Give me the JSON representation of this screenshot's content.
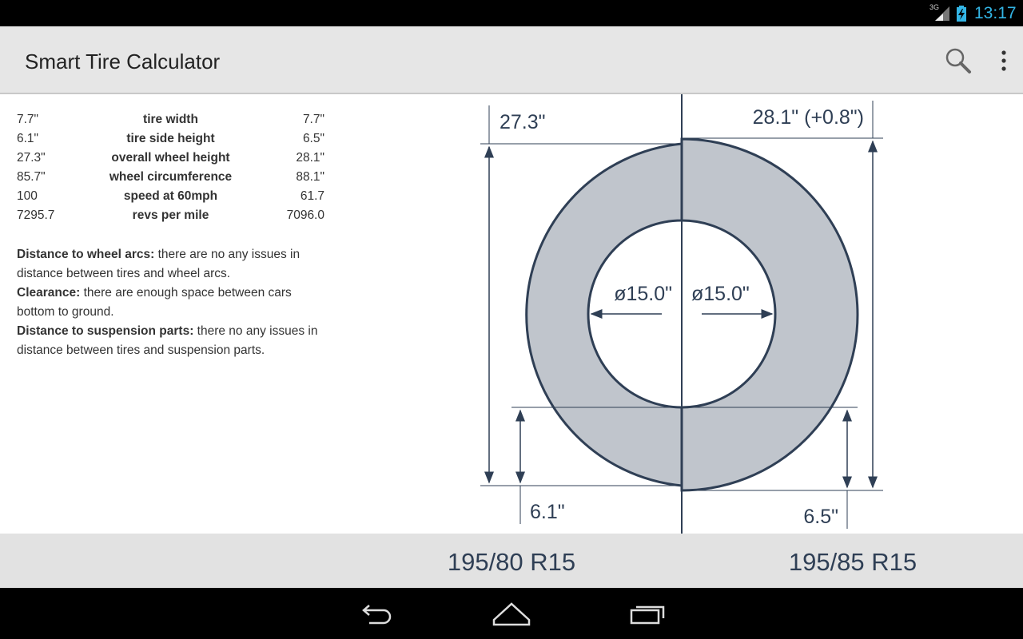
{
  "status_bar": {
    "network": "3G",
    "time": "13:17"
  },
  "app": {
    "title": "Smart Tire Calculator"
  },
  "actions": {
    "search_icon": "search-icon",
    "overflow_icon": "overflow-menu-icon"
  },
  "stats": [
    {
      "label": "tire width",
      "left": "7.7\"",
      "right": "7.7\""
    },
    {
      "label": "tire side height",
      "left": "6.1\"",
      "right": "6.5\""
    },
    {
      "label": "overall wheel height",
      "left": "27.3\"",
      "right": "28.1\""
    },
    {
      "label": "wheel circumference",
      "left": "85.7\"",
      "right": "88.1\""
    },
    {
      "label": "speed at 60mph",
      "left": "100",
      "right": "61.7"
    },
    {
      "label": "revs per mile",
      "left": "7295.7",
      "right": "7096.0"
    }
  ],
  "notes": [
    {
      "title": "Distance to wheel arcs:",
      "text": " there are no any issues in distance between tires and wheel arcs."
    },
    {
      "title": "Clearance:",
      "text": " there are enough space between cars bottom to ground."
    },
    {
      "title": "Distance to suspension parts:",
      "text": " there no any issues in distance between tires and suspension parts."
    }
  ],
  "diagram": {
    "left_height": "27.3\"",
    "right_height": "28.1\" (+0.8\")",
    "left_rim": "ø15.0\"",
    "right_rim": "ø15.0\"",
    "left_side": "6.1\"",
    "right_side": "6.5\""
  },
  "tire_sizes": {
    "left": "195/80 R15",
    "right": "195/85 R15"
  },
  "nav": {
    "back_icon": "back-icon",
    "home_icon": "home-icon",
    "recents_icon": "recent-apps-icon"
  },
  "colors": {
    "accent": "#33b5e5",
    "tire_fill": "#c0c5cc",
    "line": "#2f3f55"
  }
}
